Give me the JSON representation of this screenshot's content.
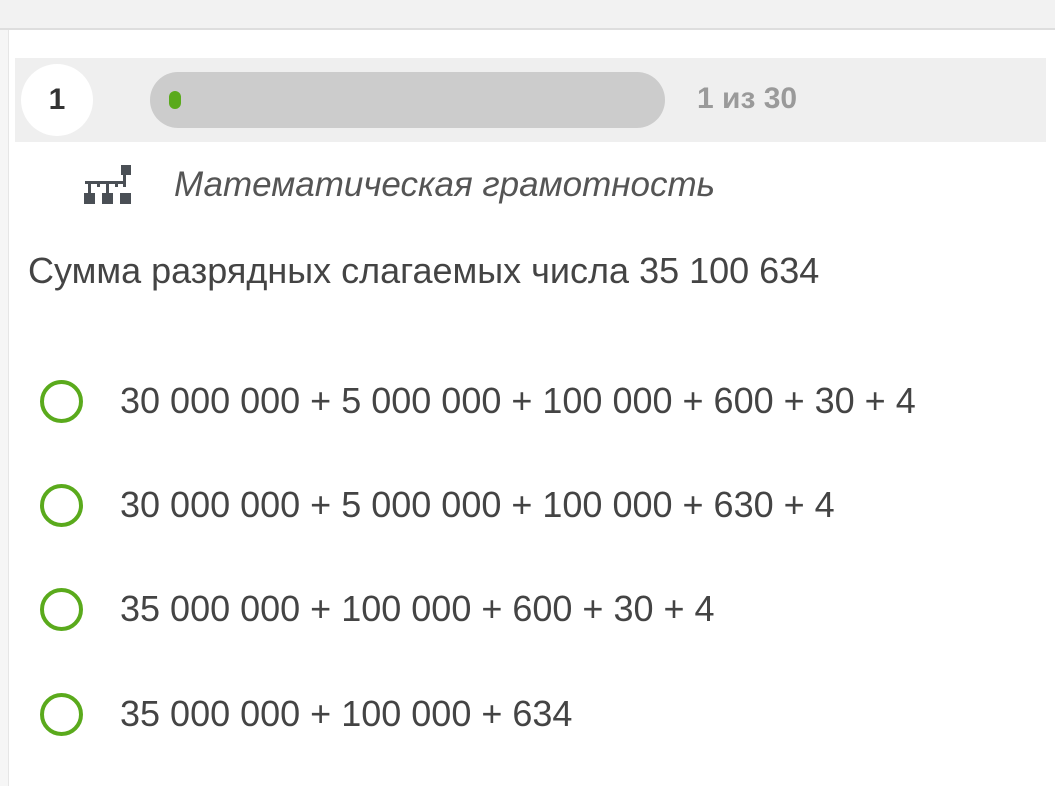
{
  "progress": {
    "question_number": "1",
    "counter_text": "1 из 30",
    "fraction_complete": 0.0333,
    "fill_color": "#5aaa1c"
  },
  "subject": {
    "icon": "hierarchy-icon",
    "label": "Математическая грамотность"
  },
  "question": {
    "text": "Сумма разрядных слагаемых числа 35 100 634"
  },
  "options": [
    {
      "label": "30 000 000 + 5 000 000 + 100 000 + 600 + 30 + 4"
    },
    {
      "label": "30 000 000 + 5 000 000 + 100 000 + 630 + 4"
    },
    {
      "label": "35 000 000 + 100 000 + 600 + 30 + 4"
    },
    {
      "label": "35 000 000 + 100 000 + 634"
    }
  ],
  "colors": {
    "accent": "#5aaa1c",
    "text": "#444444",
    "muted": "#9a9a9a"
  }
}
